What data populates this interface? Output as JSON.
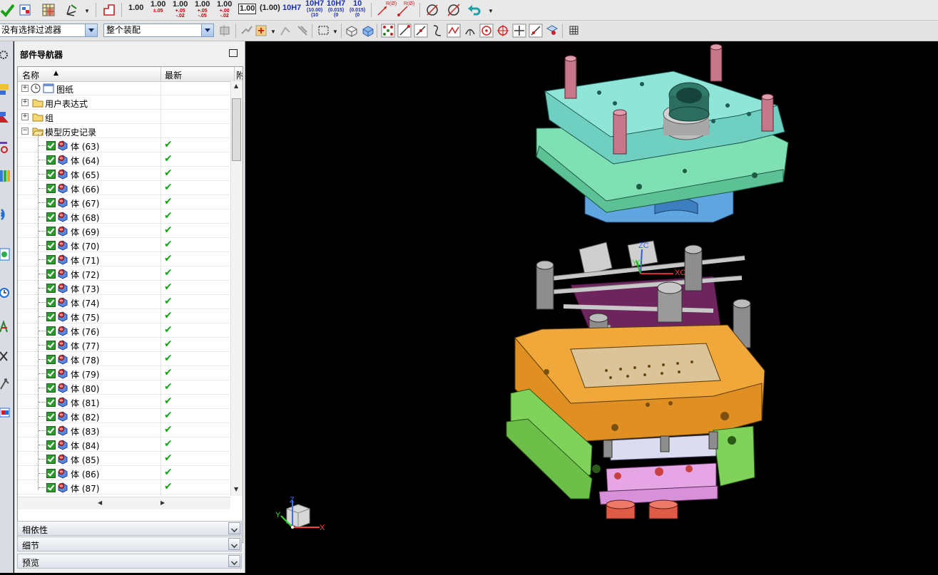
{
  "toolbar_top": {
    "dim_labels": [
      "1.00",
      "1.00",
      "1.00",
      "1.00",
      "1.00",
      "1.00",
      "(1.00)",
      "10H7",
      "10H7",
      "10H7",
      "10"
    ],
    "dim_sub": [
      "",
      "±.05",
      "+.05\n-.02",
      "+.05\n-.05",
      "+.00\n-.02",
      "",
      "",
      "",
      "(10.00)\n(10",
      "(0.015)\n(0",
      "(0.015)\n(0"
    ],
    "radius_labels": [
      "R(Ø)",
      "R(Ø)"
    ]
  },
  "toolbar_second": {
    "filter_value": "没有选择过滤器",
    "assembly_value": "整个装配"
  },
  "navigator": {
    "title": "部件导航器",
    "col_name": "名称",
    "col_latest": "最新",
    "col_third": "附",
    "top_nodes": [
      {
        "label": "图纸",
        "icon": "drawing-icon"
      },
      {
        "label": "用户表达式",
        "icon": "folder-icon"
      },
      {
        "label": "组",
        "icon": "folder-icon"
      },
      {
        "label": "模型历史记录",
        "icon": "folder-open-icon"
      }
    ],
    "bodies": [
      {
        "label": "体 (63)",
        "latest": "✔"
      },
      {
        "label": "体 (64)",
        "latest": "✔"
      },
      {
        "label": "体 (65)",
        "latest": "✔"
      },
      {
        "label": "体 (66)",
        "latest": "✔"
      },
      {
        "label": "体 (67)",
        "latest": "✔"
      },
      {
        "label": "体 (68)",
        "latest": "✔"
      },
      {
        "label": "体 (69)",
        "latest": "✔"
      },
      {
        "label": "体 (70)",
        "latest": "✔"
      },
      {
        "label": "体 (71)",
        "latest": "✔"
      },
      {
        "label": "体 (72)",
        "latest": "✔"
      },
      {
        "label": "体 (73)",
        "latest": "✔"
      },
      {
        "label": "体 (74)",
        "latest": "✔"
      },
      {
        "label": "体 (75)",
        "latest": "✔"
      },
      {
        "label": "体 (76)",
        "latest": "✔"
      },
      {
        "label": "体 (77)",
        "latest": "✔"
      },
      {
        "label": "体 (78)",
        "latest": "✔"
      },
      {
        "label": "体 (79)",
        "latest": "✔"
      },
      {
        "label": "体 (80)",
        "latest": "✔"
      },
      {
        "label": "体 (81)",
        "latest": "✔"
      },
      {
        "label": "体 (82)",
        "latest": "✔"
      },
      {
        "label": "体 (83)",
        "latest": "✔"
      },
      {
        "label": "体 (84)",
        "latest": "✔"
      },
      {
        "label": "体 (85)",
        "latest": "✔"
      },
      {
        "label": "体 (86)",
        "latest": "✔"
      },
      {
        "label": "体 (87)",
        "latest": "✔"
      }
    ],
    "panels": [
      "相依性",
      "细节",
      "预览"
    ]
  },
  "viewport": {
    "wcs_labels": {
      "zc": "ZC",
      "yc": "YC",
      "xc": "XC"
    },
    "triad_labels": {
      "z": "Z",
      "y": "Y",
      "x": "X"
    }
  },
  "colors": {
    "top_plate": "#8fe6d8",
    "cavity_plate": "#f0a83a",
    "clamp_plate": "#7fd35a",
    "ejector_plate": "#e6a6e6",
    "background": "#000000"
  }
}
